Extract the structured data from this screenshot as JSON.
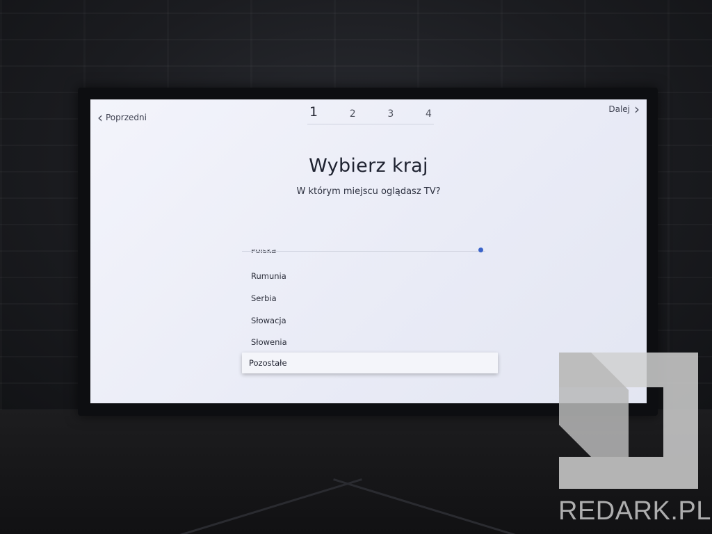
{
  "nav": {
    "prev_label": "Poprzedni",
    "next_label": "Dalej"
  },
  "steps": [
    "1",
    "2",
    "3",
    "4"
  ],
  "active_step": "1",
  "page": {
    "title": "Wybierz kraj",
    "subtitle": "W którym miejscu oglądasz TV?"
  },
  "countries": {
    "partial": "Polska",
    "items": [
      "Rumunia",
      "Serbia",
      "Słowacja",
      "Słowenia"
    ],
    "selected": "Pozostałe"
  },
  "watermark": {
    "text": "REDARK.PL"
  },
  "colors": {
    "accent": "#3a63c9",
    "screen_bg": "#eef0f8",
    "watermark": "#c9c9c9"
  }
}
